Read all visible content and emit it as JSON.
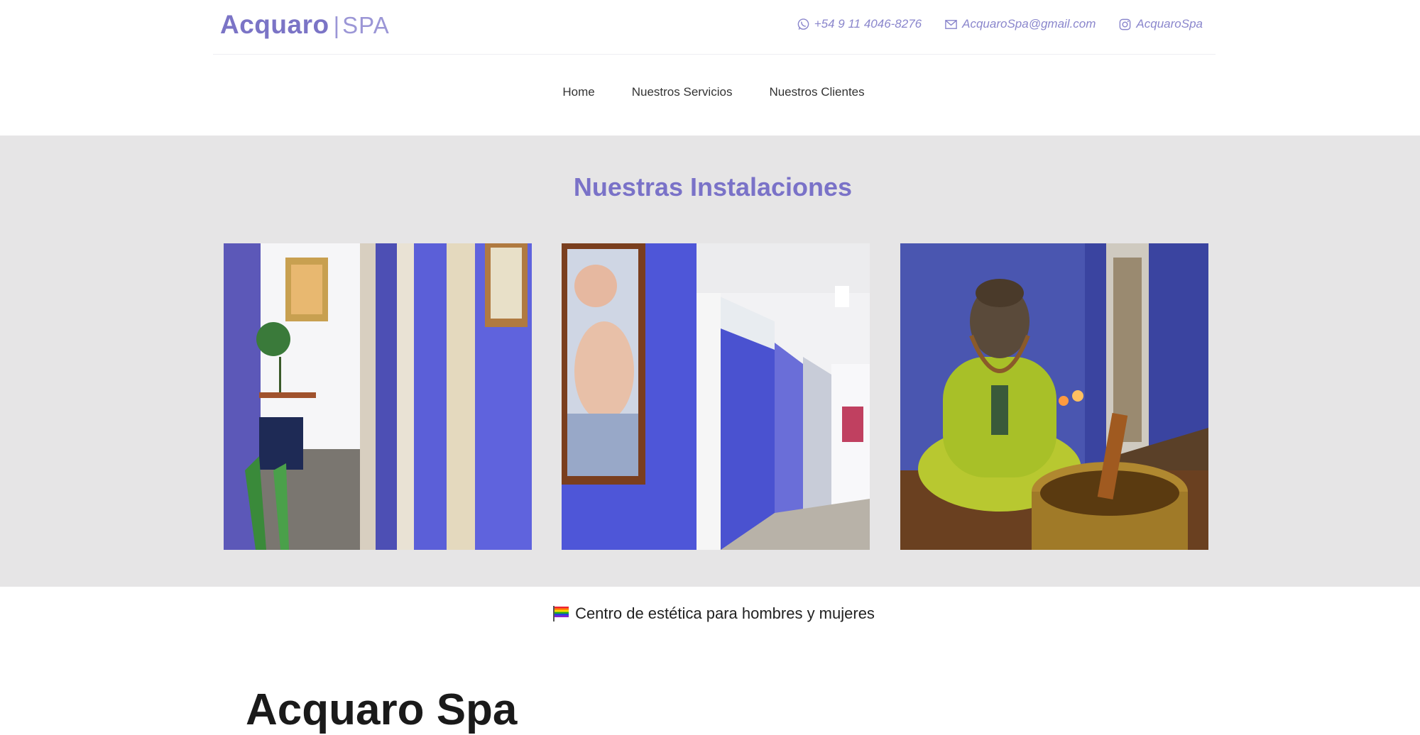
{
  "header": {
    "logo_main": "Acquaro",
    "logo_sep": "|",
    "logo_sub": "SPA",
    "phone": "+54 9 11 4046-8276",
    "email": "AcquaroSpa@gmail.com",
    "instagram": "AcquaroSpa"
  },
  "nav": {
    "items": [
      "Home",
      "Nuestros Servicios",
      "Nuestros Clientes"
    ]
  },
  "gallery": {
    "title": "Nuestras Instalaciones"
  },
  "tagline": "Centro de estética para hombres y mujeres",
  "main_heading": "Acquaro Spa",
  "colors": {
    "brand": "#7b74c6",
    "section_bg": "#e6e5e6",
    "wall_purple": "#5b5fd8"
  }
}
